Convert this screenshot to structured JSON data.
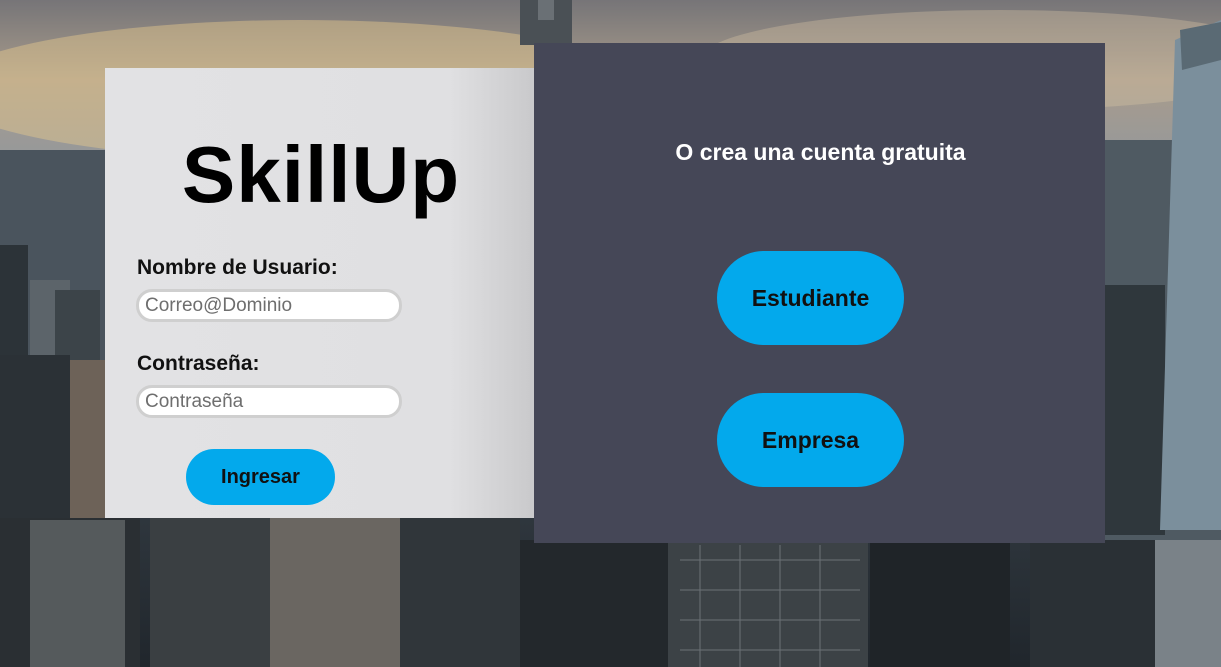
{
  "login": {
    "brand": "SkillUp",
    "username_label": "Nombre de Usuario:",
    "username_placeholder": "Correo@Dominio",
    "password_label": "Contraseña:",
    "password_placeholder": "Contraseña",
    "submit_label": "Ingresar"
  },
  "signup": {
    "heading": "O crea una cuenta gratuita",
    "student_label": "Estudiante",
    "company_label": "Empresa"
  },
  "colors": {
    "accent": "#03a9ec",
    "login_panel_bg": "#e2e2e4",
    "signup_panel_bg": "#454757"
  }
}
